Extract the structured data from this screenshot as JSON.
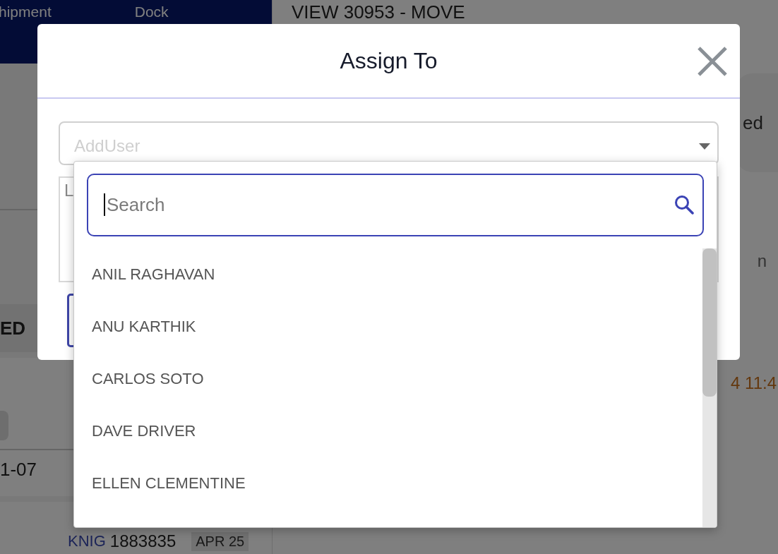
{
  "background": {
    "header_tabs": [
      "hipment",
      "Dock"
    ],
    "view_title": "VIEW 30953 - MOVE",
    "status_chip": "ed",
    "side_label": "n",
    "section_label": "ED",
    "row_date": "1-07",
    "order_prefix": "KNIG",
    "order_number": "1883835",
    "order_date": "APR 25",
    "timestamp": "4 11:4"
  },
  "modal": {
    "title": "Assign To",
    "user_select": {
      "placeholder": "AddUser"
    },
    "notes_text": "L",
    "dropdown": {
      "search": {
        "placeholder": "Search"
      },
      "options": [
        {
          "label": "ANIL RAGHAVAN"
        },
        {
          "label": "ANU KARTHIK"
        },
        {
          "label": "CARLOS SOTO"
        },
        {
          "label": "DAVE DRIVER"
        },
        {
          "label": "ELLEN CLEMENTINE"
        }
      ]
    }
  }
}
